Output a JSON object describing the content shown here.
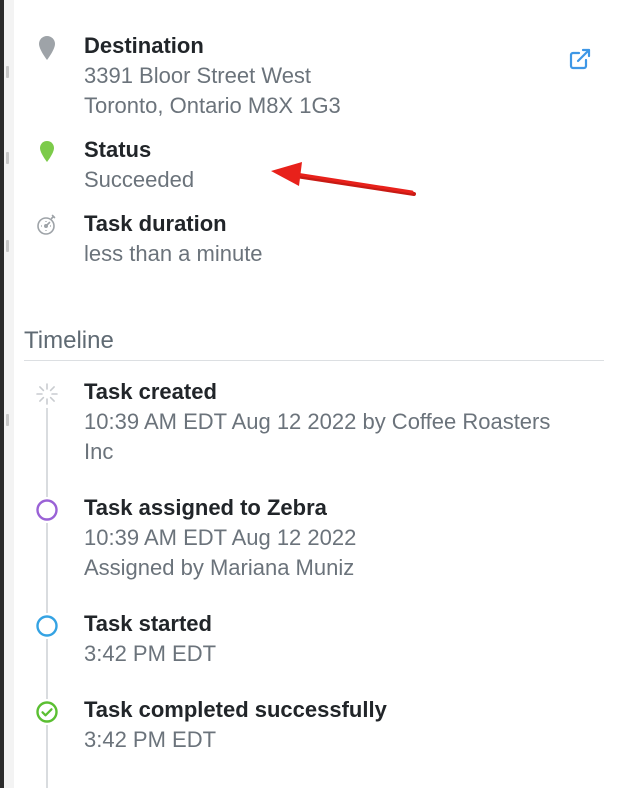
{
  "details": {
    "destination": {
      "icon": "map-pin-gray-icon",
      "label": "Destination",
      "address_line1": "3391 Bloor Street West",
      "address_line2": "Toronto, Ontario M8X 1G3",
      "link_icon": "external-link-icon"
    },
    "status": {
      "icon": "map-pin-green-icon",
      "label": "Status",
      "value": "Succeeded"
    },
    "duration": {
      "icon": "stopwatch-icon",
      "label": "Task duration",
      "value": "less than a minute"
    }
  },
  "timeline": {
    "title": "Timeline",
    "events": [
      {
        "icon": "spinner-icon",
        "title": "Task created",
        "lines": [
          "10:39 AM EDT Aug 12 2022 by Coffee Roasters",
          "Inc"
        ]
      },
      {
        "icon": "circle-purple-icon",
        "title": "Task assigned to Zebra",
        "lines": [
          "10:39 AM EDT Aug 12 2022",
          "Assigned by Mariana Muniz"
        ]
      },
      {
        "icon": "circle-blue-icon",
        "title": "Task started",
        "lines": [
          "3:42 PM EDT"
        ]
      },
      {
        "icon": "check-circle-green-icon",
        "title": "Task completed successfully",
        "lines": [
          "3:42 PM EDT"
        ]
      }
    ]
  },
  "colors": {
    "link_blue": "#3e97e6",
    "status_green": "#7ccb4a",
    "purple": "#9a62d6",
    "blue": "#35a3e3",
    "success_green": "#5bbf32",
    "arrow_red": "#e8211b"
  }
}
